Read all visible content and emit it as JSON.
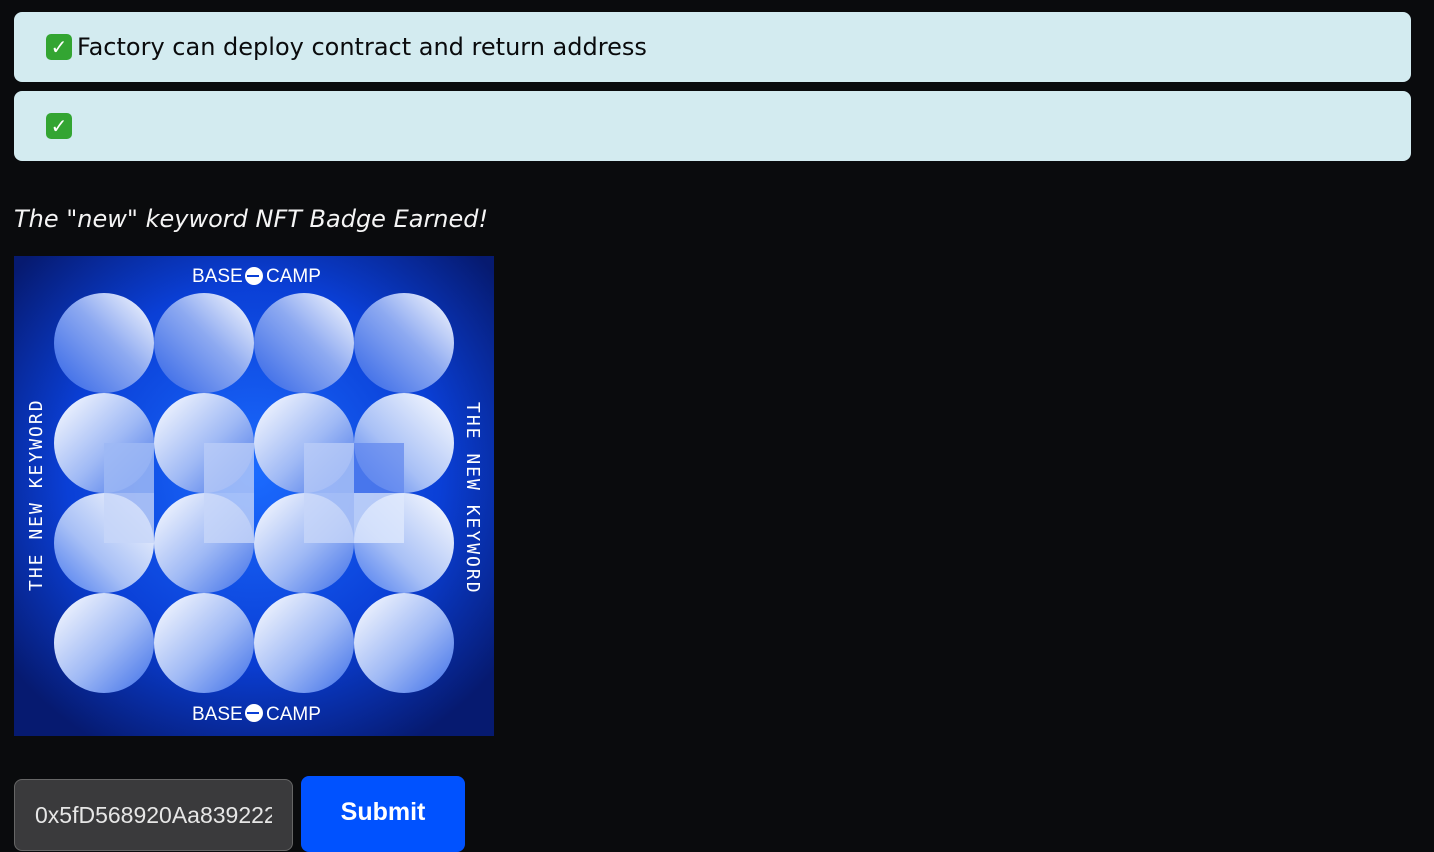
{
  "results": [
    {
      "icon": "check-mark-icon",
      "text": "Factory can deploy contract and return address",
      "check": "✓"
    },
    {
      "icon": "check-mark-icon",
      "text": "",
      "check": "✓"
    }
  ],
  "badge": {
    "title": "The \"new\" keyword NFT Badge Earned!",
    "brand_top": "BASE",
    "brand_top_2": "CAMP",
    "brand_bottom": "BASE",
    "brand_bottom_2": "CAMP",
    "side_left": "THE NEW KEYWORD",
    "side_right": "THE NEW KEYWORD"
  },
  "form": {
    "address_value": "0x5fD568920Aa839222",
    "submit_label": "Submit"
  },
  "colors": {
    "background": "#0a0b0d",
    "result_bg": "#d3ebf0",
    "check_green": "#33a532",
    "brand_blue": "#0052ff"
  }
}
